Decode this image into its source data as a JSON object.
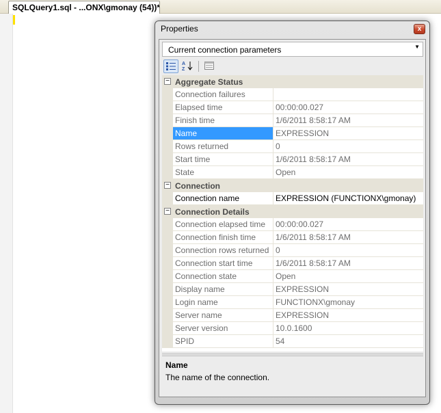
{
  "editor": {
    "tab_title": "SQLQuery1.sql - ...ONX\\gmonay (54))*"
  },
  "properties": {
    "title": "Properties",
    "close_label": "x",
    "object_selector": "Current connection parameters",
    "categories": [
      {
        "name": "Aggregate Status",
        "toggle": "−",
        "rows": [
          {
            "name": "Connection failures",
            "value": "",
            "editable": false,
            "selected": false
          },
          {
            "name": "Elapsed time",
            "value": "00:00:00.027",
            "editable": false,
            "selected": false
          },
          {
            "name": "Finish time",
            "value": "1/6/2011 8:58:17 AM",
            "editable": false,
            "selected": false
          },
          {
            "name": "Name",
            "value": "EXPRESSION",
            "editable": false,
            "selected": true
          },
          {
            "name": "Rows returned",
            "value": "0",
            "editable": false,
            "selected": false
          },
          {
            "name": "Start time",
            "value": "1/6/2011 8:58:17 AM",
            "editable": false,
            "selected": false
          },
          {
            "name": "State",
            "value": "Open",
            "editable": false,
            "selected": false
          }
        ]
      },
      {
        "name": "Connection",
        "toggle": "−",
        "rows": [
          {
            "name": "Connection name",
            "value": "EXPRESSION (FUNCTIONX\\gmonay)",
            "editable": true,
            "selected": false
          }
        ]
      },
      {
        "name": "Connection Details",
        "toggle": "−",
        "rows": [
          {
            "name": "Connection elapsed time",
            "value": "00:00:00.027",
            "editable": false,
            "selected": false
          },
          {
            "name": "Connection finish time",
            "value": "1/6/2011 8:58:17 AM",
            "editable": false,
            "selected": false
          },
          {
            "name": "Connection rows returned",
            "value": "0",
            "editable": false,
            "selected": false
          },
          {
            "name": "Connection start time",
            "value": "1/6/2011 8:58:17 AM",
            "editable": false,
            "selected": false
          },
          {
            "name": "Connection state",
            "value": "Open",
            "editable": false,
            "selected": false
          },
          {
            "name": "Display name",
            "value": "EXPRESSION",
            "editable": false,
            "selected": false
          },
          {
            "name": "Login name",
            "value": "FUNCTIONX\\gmonay",
            "editable": false,
            "selected": false
          },
          {
            "name": "Server name",
            "value": "EXPRESSION",
            "editable": false,
            "selected": false
          },
          {
            "name": "Server version",
            "value": "10.0.1600",
            "editable": false,
            "selected": false
          },
          {
            "name": "SPID",
            "value": "54",
            "editable": false,
            "selected": false
          }
        ]
      }
    ],
    "description": {
      "title": "Name",
      "text": "The name of the connection."
    }
  },
  "icons": {
    "categorized": "categorized-icon",
    "alphabetical": "sort-alphabetical-icon",
    "property_pages": "property-pages-icon",
    "dropdown": "chevron-down-icon",
    "close": "close-icon"
  }
}
